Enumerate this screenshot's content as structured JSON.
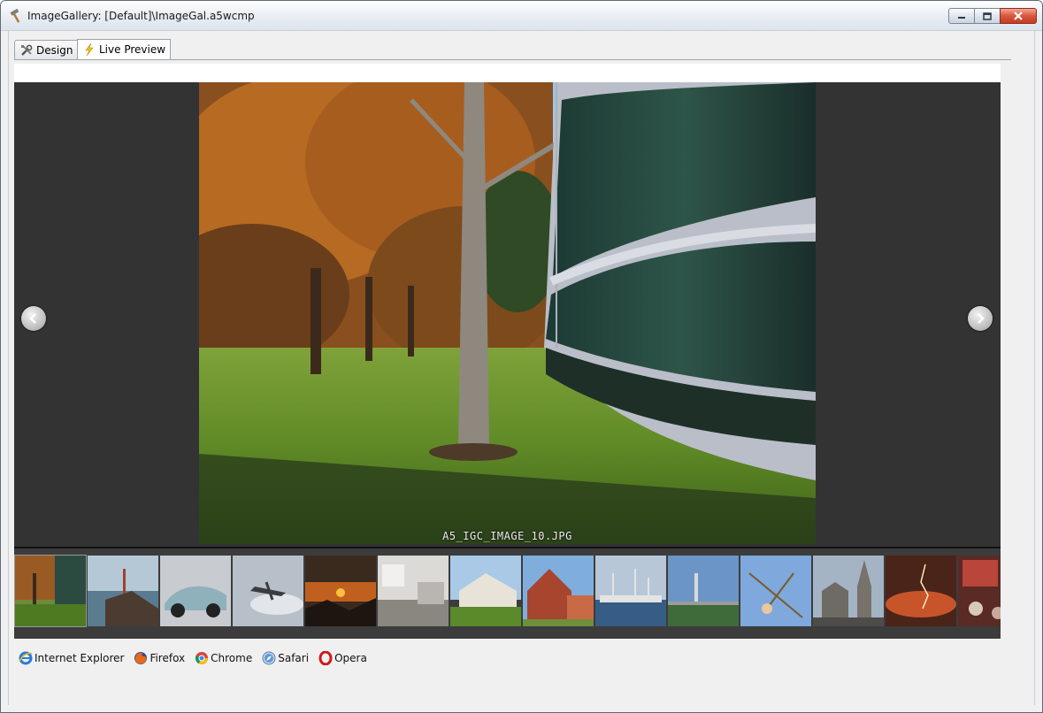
{
  "window": {
    "title": "ImageGallery: [Default]\\ImageGal.a5wcmp"
  },
  "tabs": [
    {
      "label": "Design",
      "icon": "tools-icon",
      "selected": false
    },
    {
      "label": "Live Preview",
      "icon": "lightning-icon",
      "selected": true
    }
  ],
  "gallery": {
    "current_caption": "A5_IGC_IMAGE_10.JPG",
    "thumbnail_count": 14,
    "selected_thumbnail_index": 0,
    "background_color": "#333333"
  },
  "browsers": [
    {
      "label": "Internet Explorer",
      "icon": "internet-explorer-icon"
    },
    {
      "label": "Firefox",
      "icon": "firefox-icon"
    },
    {
      "label": "Chrome",
      "icon": "chrome-icon"
    },
    {
      "label": "Safari",
      "icon": "safari-icon"
    },
    {
      "label": "Opera",
      "icon": "opera-icon"
    }
  ]
}
